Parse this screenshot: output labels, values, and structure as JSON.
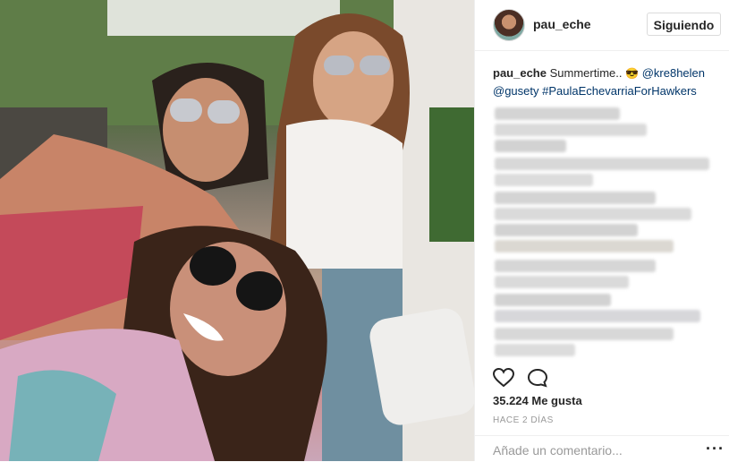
{
  "post": {
    "photo_alt": "",
    "header": {
      "username": "pau_eche",
      "follow_label": "Siguiendo"
    },
    "caption": {
      "username": "pau_eche",
      "text": "Summertime..",
      "emoji": "😎",
      "mention1": "@kre8helen",
      "mention2": "@gusety",
      "hashtag": "#PaulaEchevarriaForHawkers"
    },
    "likes": "35.224 Me gusta",
    "date": "HACE 2 DÍAS",
    "comment": {
      "placeholder": "Añade un comentario...",
      "more_label": "···"
    },
    "icons": [
      "heart-icon",
      "comment-icon"
    ]
  }
}
